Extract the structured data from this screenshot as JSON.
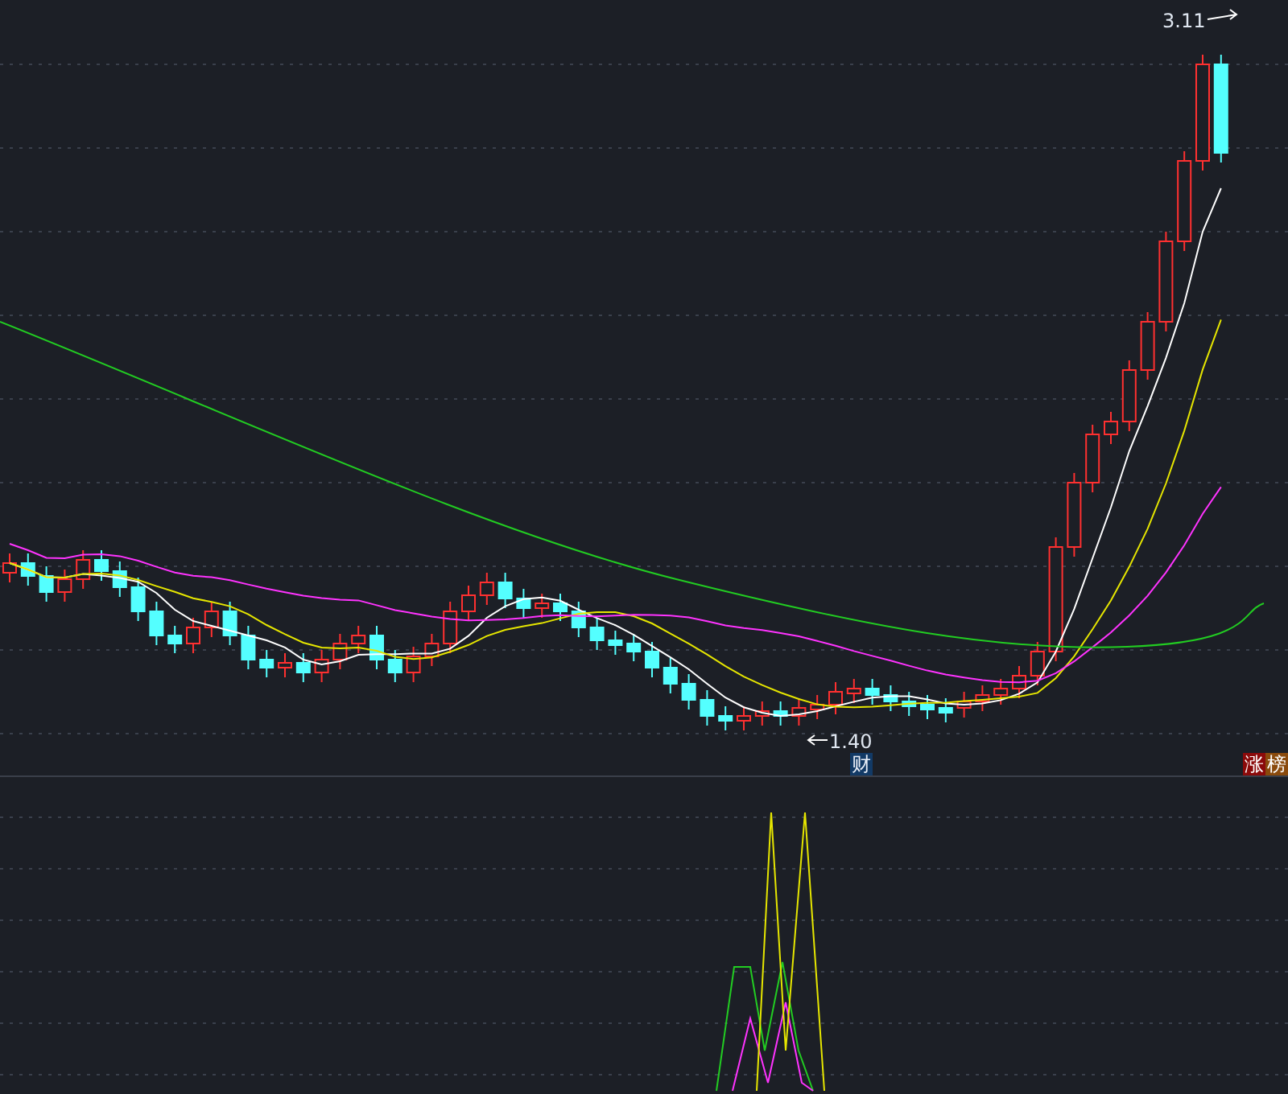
{
  "price_chart": {
    "high_label": "3.11",
    "low_label": "1.40",
    "event_marker": "财",
    "tags": [
      {
        "text": "涨",
        "color": "#8b0a0a"
      },
      {
        "text": "榜",
        "color": "#8a4a0c"
      }
    ]
  }
}
